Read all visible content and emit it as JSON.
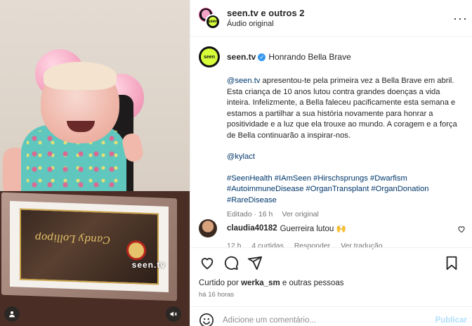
{
  "media": {
    "watermark": "seen.tv",
    "certificate_script": "Candy Lollipop"
  },
  "header": {
    "username": "seen.tv e outros 2",
    "audio": "Áudio original",
    "more_icon": "ellipsis-icon"
  },
  "caption": {
    "avatar_text": "seen",
    "username": "seen.tv",
    "title": "Honrando Bella Brave",
    "mention": "@seen.tv",
    "body_line1": " apresentou-te pela primeira vez a Bella Brave em abril. Esta criança de 10 anos lutou contra grandes doenças a vida inteira. Infelizmente, a Bella faleceu pacificamente esta semana e estamos a partilhar a sua história novamente para honrar a positividade e a luz que ela trouxe ao mundo. A coragem e a força de Bella continuarão a inspirar-nos.",
    "mention2": "@kylact",
    "hashtags": "#SeenHealth #IAmSeen #Hirschsprungs #Dwarfism #AutoimmuneDisease #OrganTransplant #OrganDonation #RareDisease",
    "edited": "Editado · 16 h",
    "see_translation": "Ver original"
  },
  "comment": {
    "username": "claudia40182",
    "text": "Guerreira lutou 🙌",
    "time": "12 h",
    "likes": "4 curtidas",
    "reply": "Responder",
    "translation": "Ver tradução"
  },
  "likes": {
    "prefix": "Curtido por ",
    "user": "werka_sm",
    "suffix": " e outras pessoas"
  },
  "time": "há 16 horas",
  "add_comment": {
    "placeholder": "Adicione um comentário...",
    "publish": "Publicar"
  }
}
